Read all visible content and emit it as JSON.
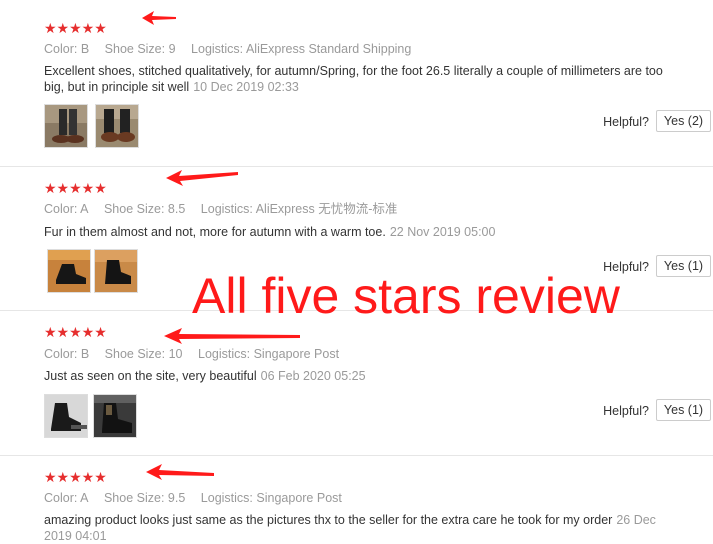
{
  "reviews": [
    {
      "stars": "★★★★★",
      "color_label": "Color:",
      "color": "B",
      "size_label": "Shoe Size:",
      "size": "9",
      "logistics_label": "Logistics:",
      "logistics": "AliExpress Standard Shipping",
      "text": "Excellent shoes, stitched qualitatively, for autumn/Spring, for the foot 26.5 literally a couple of millimeters are too big, but in principle sit well",
      "date": "10 Dec 2019 02:33",
      "helpful_label": "Helpful?",
      "yes_label": "Yes (2)"
    },
    {
      "stars": "★★★★★",
      "color_label": "Color:",
      "color": "A",
      "size_label": "Shoe Size:",
      "size": "8.5",
      "logistics_label": "Logistics:",
      "logistics": "AliExpress 无忧物流-标准",
      "text": "Fur in them almost and not, more for autumn with a warm toe.",
      "date": "22 Nov 2019 05:00",
      "helpful_label": "Helpful?",
      "yes_label": "Yes (1)"
    },
    {
      "stars": "★★★★★",
      "color_label": "Color:",
      "color": "B",
      "size_label": "Shoe Size:",
      "size": "10",
      "logistics_label": "Logistics:",
      "logistics": "Singapore Post",
      "text": "Just as seen on the site, very beautiful",
      "date": "06 Feb 2020 05:25",
      "helpful_label": "Helpful?",
      "yes_label": "Yes (1)"
    },
    {
      "stars": "★★★★★",
      "color_label": "Color:",
      "color": "A",
      "size_label": "Shoe Size:",
      "size": "9.5",
      "logistics_label": "Logistics:",
      "logistics": "Singapore Post",
      "text": "amazing product looks just same as the pictures thx to the seller for the extra care he took for my order",
      "date": "26 Dec 2019 04:01"
    }
  ],
  "overlay_text": "All five stars review",
  "colors": {
    "star": "#e62e2e",
    "annotation": "#ff1a1a",
    "muted": "#9a9a9a"
  }
}
